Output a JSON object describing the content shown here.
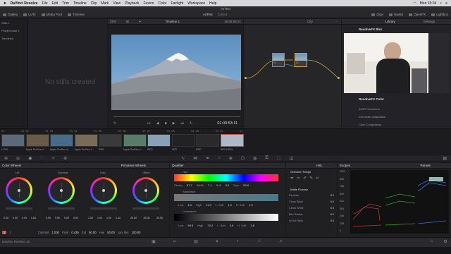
{
  "menubar": {
    "app": "DaVinci Resolve",
    "items": [
      "File",
      "Edit",
      "Trim",
      "Timeline",
      "Clip",
      "Mark",
      "View",
      "Playback",
      "Fusion",
      "Color",
      "Fairlight",
      "Workspace",
      "Help"
    ],
    "right": [
      "Mon 15:04"
    ]
  },
  "window_title": "AirTest",
  "toolbar": {
    "gallery": "Gallery",
    "luts": "LUTs",
    "media_pool": "Media Pool",
    "timeline": "Timeline",
    "project": "AirTest",
    "edited": "Edited",
    "clips": "Clips",
    "nodes": "Nodes",
    "openfx": "OpenFX",
    "lightbox": "Lightbox"
  },
  "viewer": {
    "zoom": "29%",
    "timeline_name": "Timeline 1",
    "timecode_top": "16:05:06:21",
    "clip_label": "Clip",
    "timecode": "01:00:53:11"
  },
  "gallery": {
    "items": [
      "Stills 1",
      "PowerGrade 1",
      "Timelines"
    ],
    "empty": "No stills created"
  },
  "nodes": {
    "n1": "01",
    "n2": "02"
  },
  "library": {
    "tabs": [
      "Library",
      "Settings"
    ],
    "blur_header": "ResolveFX Blur",
    "color_header": "ResolveFX Color",
    "color_items": [
      "ACES Transform",
      "Chromatic Adaptation",
      "Color Compressor"
    ]
  },
  "clips": [
    {
      "num": "01",
      "v": "V1",
      "name": "H.264"
    },
    {
      "num": "02",
      "v": "V1",
      "name": "Apple ProRes 4..."
    },
    {
      "num": "03",
      "v": "V1",
      "name": "Apple ProRes 4..."
    },
    {
      "num": "04",
      "v": "V1",
      "name": "Apple ProRes 4..."
    },
    {
      "num": "05",
      "v": "V1",
      "name": "RED"
    },
    {
      "num": "06",
      "v": "V1",
      "name": "Apple ProRes 4..."
    },
    {
      "num": "07",
      "v": "V1",
      "name": "RED"
    },
    {
      "num": "08",
      "v": "V1",
      "name": "RED"
    },
    {
      "num": "09",
      "v": "V1",
      "name": "RED"
    },
    {
      "num": "10",
      "v": "V1",
      "name": "RED HDRx"
    }
  ],
  "color_wheels": {
    "title": "Color Wheels",
    "mode": "Primaries Wheels",
    "wheels": [
      {
        "name": "Lift",
        "vals": [
          "0.00",
          "0.00",
          "0.00",
          "0.00"
        ]
      },
      {
        "name": "Gamma",
        "vals": [
          "0.00",
          "0.00",
          "0.00",
          "0.00"
        ]
      },
      {
        "name": "Gain",
        "vals": [
          "1.00",
          "1.00",
          "1.00",
          "1.00"
        ]
      },
      {
        "name": "Offset",
        "vals": [
          "25.00",
          "25.00",
          "25.00"
        ]
      }
    ],
    "bottom": {
      "page": "1",
      "page2": "2",
      "contrast_l": "Contrast",
      "contrast": "1.000",
      "pivot_l": "Pivot",
      "pivot": "0.435",
      "sat_l": "Sat",
      "sat": "50.00",
      "hue_l": "Hue",
      "hue": "50.00",
      "lummix_l": "Lum Mix",
      "lummix": "100.00"
    }
  },
  "qualifier": {
    "title": "Qualifier",
    "mode": "HSL",
    "hue": {
      "label": "Hue",
      "center_l": "Center",
      "center": "87.7",
      "width_l": "Width",
      "width": "7.1",
      "soft_l": "Soft",
      "soft": "3.2",
      "sym_l": "Sym",
      "sym": "50.0"
    },
    "sat": {
      "label": "Saturation",
      "low_l": "Low",
      "low": "4.0",
      "high_l": "High",
      "high": "11.9",
      "lsoft_l": "L. Soft",
      "lsoft": "1.0",
      "hsoft_l": "H. Soft",
      "hsoft": "1.0"
    },
    "lum": {
      "label": "Luminance",
      "low_l": "Low",
      "low": "59.5",
      "high_l": "High",
      "high": "70.2",
      "lsoft_l": "L. Soft",
      "lsoft": "3.6",
      "hsoft_l": "H. Soft",
      "hsoft": "2.6"
    }
  },
  "selection": {
    "title": "Selection Range",
    "matte_title": "Matte Finesse",
    "items": [
      "Denoise",
      "Clean Black",
      "Clean White",
      "Blur Radius",
      "In/Out Ratio"
    ],
    "values": [
      "0.0",
      "0.0",
      "0.0",
      "0.0",
      "0.0"
    ]
  },
  "scopes": {
    "title": "Scopes",
    "mode": "Parade",
    "scale": [
      "1023",
      "896",
      "768",
      "640",
      "512",
      "384",
      "256",
      "128",
      "0"
    ]
  },
  "footer": {
    "app": "DaVinci Resolve 16"
  }
}
